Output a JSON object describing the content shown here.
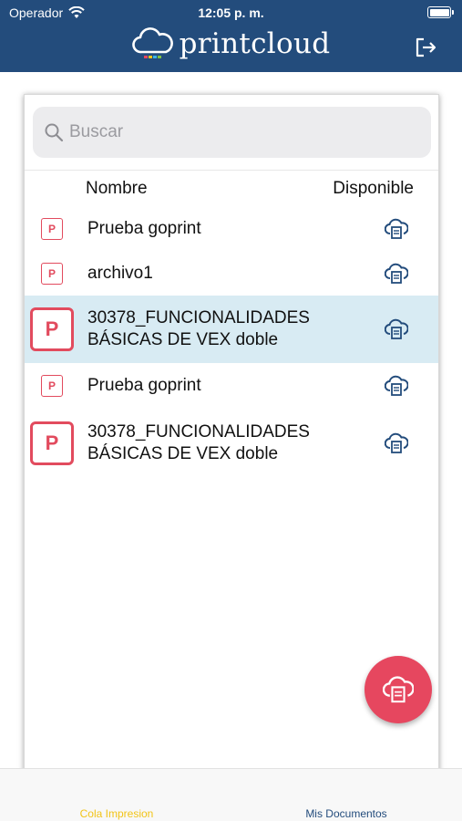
{
  "status_bar": {
    "carrier": "Operador",
    "time": "12:05 p. m."
  },
  "header": {
    "brand": "printcloud",
    "logout_icon": "logout-icon"
  },
  "search": {
    "placeholder": "Buscar",
    "value": ""
  },
  "columns": {
    "name": "Nombre",
    "available": "Disponible"
  },
  "files": [
    {
      "icon_letter": "P",
      "name": "Prueba goprint",
      "selected": false
    },
    {
      "icon_letter": "P",
      "name": "archivo1",
      "selected": false
    },
    {
      "icon_letter": "P",
      "name": "30378_FUNCIONALIDADES BÁSICAS DE VEX doble",
      "selected": true
    },
    {
      "icon_letter": "P",
      "name": "Prueba goprint",
      "selected": false
    },
    {
      "icon_letter": "P",
      "name": "30378_FUNCIONALIDADES BÁSICAS DE VEX doble",
      "selected": false
    }
  ],
  "tabs": {
    "print_queue": "Cola Impresion",
    "my_documents": "Mis Documentos"
  },
  "colors": {
    "header": "#234c7c",
    "accent": "#e6475f",
    "selected_row": "#d8ebf3",
    "active_tab": "#f2c418"
  }
}
